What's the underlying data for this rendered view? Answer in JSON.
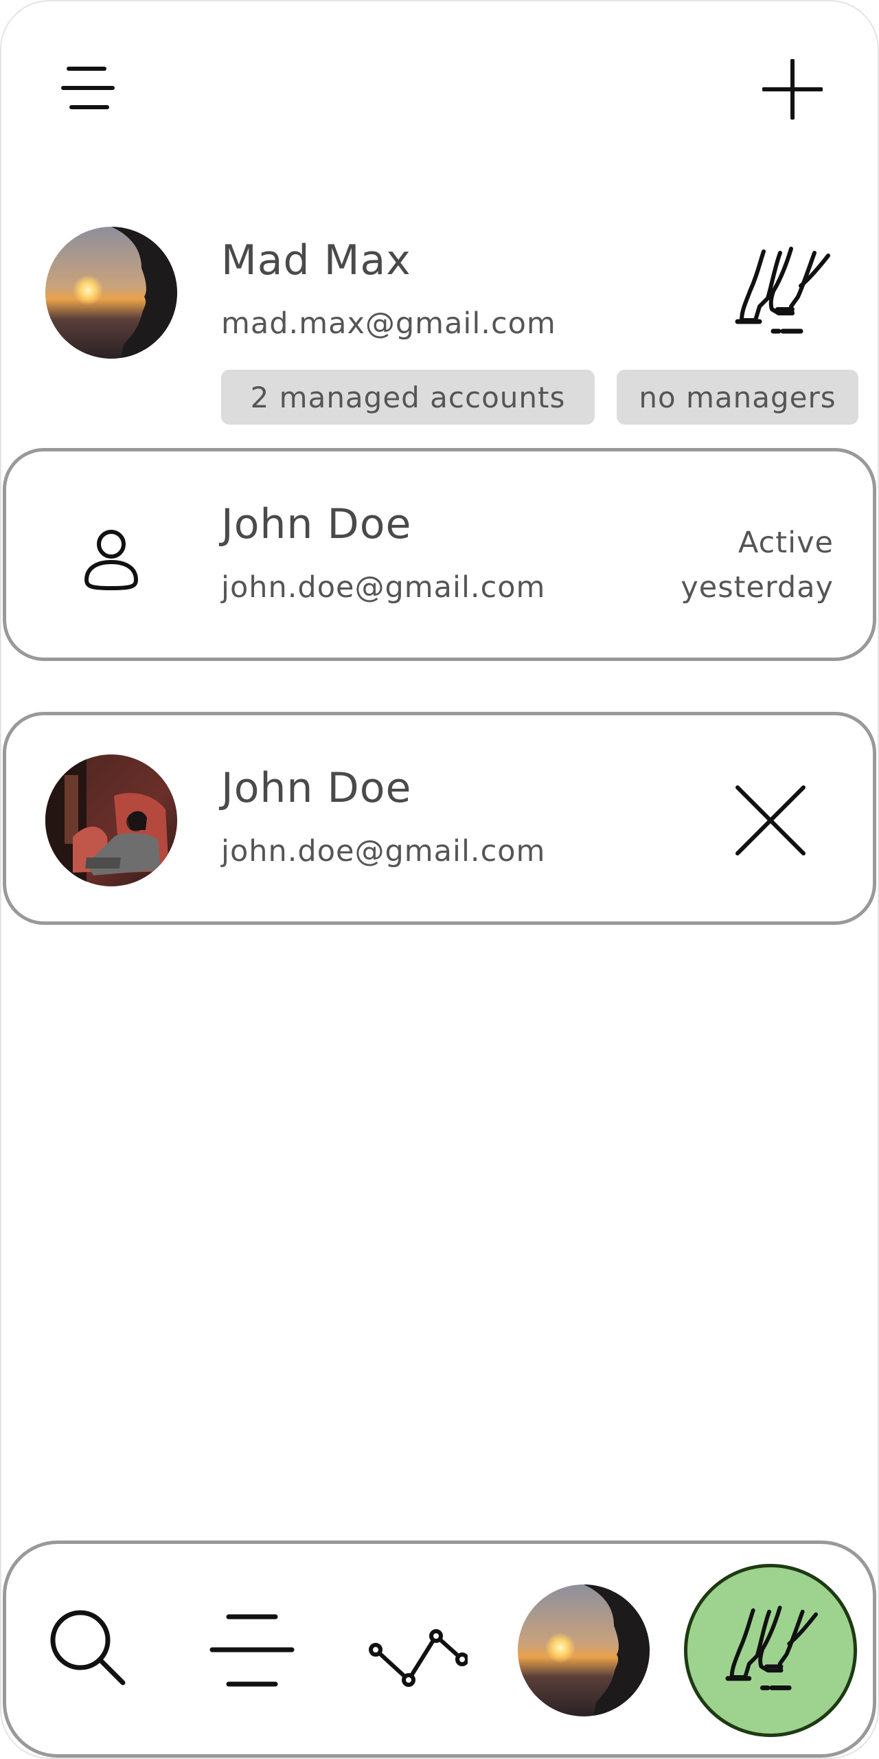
{
  "header": {
    "menu_icon": "menu-lines-icon",
    "add_icon": "plus-icon"
  },
  "current_user": {
    "name": "Mad Max",
    "email": "mad.max@gmail.com",
    "chips": [
      "2 managed accounts",
      "no managers"
    ],
    "role_icon": "manager-legs-icon"
  },
  "accounts": [
    {
      "name": "John Doe",
      "email": "john.doe@gmail.com",
      "status_line1": "Active",
      "status_line2": "yesterday",
      "avatar_icon": "person-icon"
    },
    {
      "name": "John Doe",
      "email": "john.doe@gmail.com",
      "action_icon": "close-icon"
    }
  ],
  "bottom_nav": {
    "items": [
      "search-icon",
      "menu-lines-icon",
      "activity-chart-icon",
      "profile-avatar",
      "manager-legs-icon"
    ],
    "active_color": "#9dd38f"
  }
}
